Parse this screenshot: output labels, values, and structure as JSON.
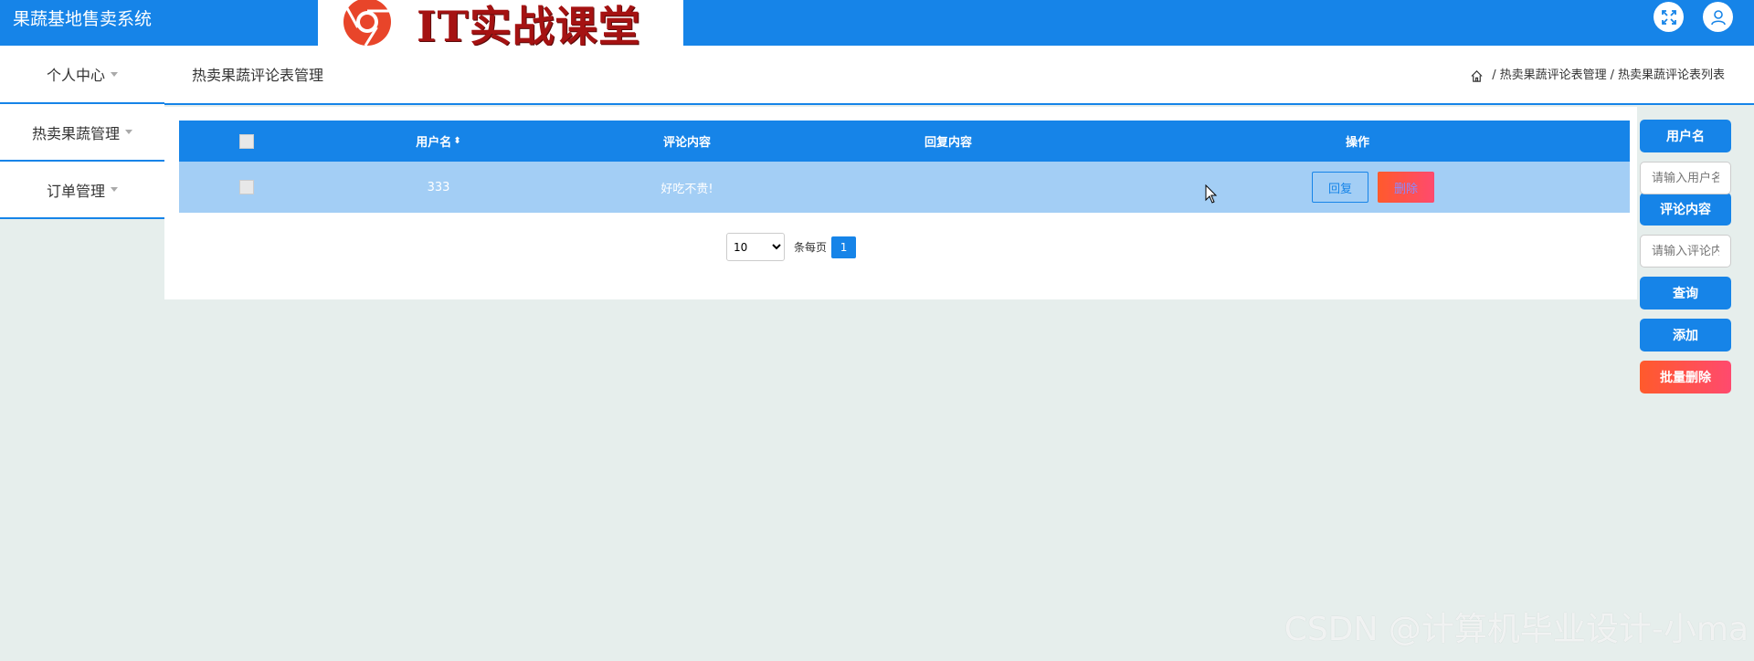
{
  "header": {
    "app_title": "果蔬基地售卖系统",
    "logo_text": "IT实战课堂",
    "icons": [
      "fullscreen-icon",
      "user-icon"
    ]
  },
  "sidebar": {
    "items": [
      {
        "label": "个人中心"
      },
      {
        "label": "热卖果蔬管理"
      },
      {
        "label": "订单管理"
      }
    ]
  },
  "crumbs": {
    "section_title": "热卖果蔬评论表管理",
    "path": [
      "热卖果蔬评论表管理",
      "热卖果蔬评论表列表"
    ]
  },
  "table": {
    "columns": [
      "用户名",
      "评论内容",
      "回复内容",
      "操作"
    ],
    "sort_symbol": "⬍",
    "rows": [
      {
        "username": "333",
        "comment": "好吃不贵!",
        "reply": "",
        "btn_reply": "回复",
        "btn_delete": "删除"
      }
    ]
  },
  "pager": {
    "page_size": "10",
    "page_size_options": [
      "10"
    ],
    "per_page_label": "条每页",
    "current_page": "1"
  },
  "search": {
    "username_label": "用户名",
    "username_placeholder": "请输入用户名",
    "comment_label": "评论内容",
    "comment_placeholder": "请输入评论内容",
    "query_label": "查询",
    "add_label": "添加",
    "batch_delete_label": "批量删除"
  },
  "watermark": "CSDN @计算机毕业设计-小ma",
  "colors": {
    "primary": "#1684e8",
    "row_bg": "#a3cef5",
    "danger_start": "#ff5a2c",
    "danger_end": "#ff4a6e",
    "page_bg": "#e6eeec"
  }
}
